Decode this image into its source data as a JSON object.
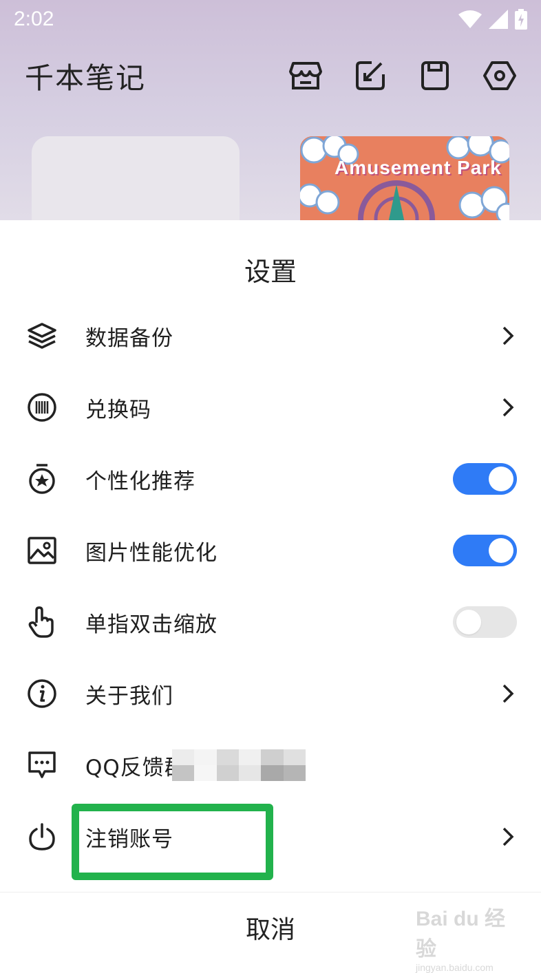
{
  "status_bar": {
    "time": "2:02"
  },
  "app": {
    "title": "千本笔记"
  },
  "header_icons": [
    "shop-icon",
    "checkin-icon",
    "save-icon",
    "settings-icon"
  ],
  "cover": {
    "title": "Amusement Park"
  },
  "sheet": {
    "title": "设置",
    "items": [
      {
        "label": "数据备份",
        "icon": "layers-icon",
        "control": "chevron"
      },
      {
        "label": "兑换码",
        "icon": "barcode-icon",
        "control": "chevron"
      },
      {
        "label": "个性化推荐",
        "icon": "badge-icon",
        "control": "toggle",
        "on": true
      },
      {
        "label": "图片性能优化",
        "icon": "image-icon",
        "control": "toggle",
        "on": true
      },
      {
        "label": "单指双击缩放",
        "icon": "finger-tap-icon",
        "control": "toggle",
        "on": false
      },
      {
        "label": "关于我们",
        "icon": "info-icon",
        "control": "chevron"
      },
      {
        "label": "QQ反馈群",
        "icon": "chat-icon",
        "control": "none"
      },
      {
        "label": "注销账号",
        "icon": "power-icon",
        "control": "chevron"
      }
    ],
    "cancel_label": "取消"
  },
  "watermark": {
    "main": "Bai du 经验",
    "sub": "jingyan.baidu.com"
  },
  "colors": {
    "toggle_on": "#2f7bf6",
    "toggle_off": "#e6e6e6",
    "highlight": "#22b24c"
  }
}
